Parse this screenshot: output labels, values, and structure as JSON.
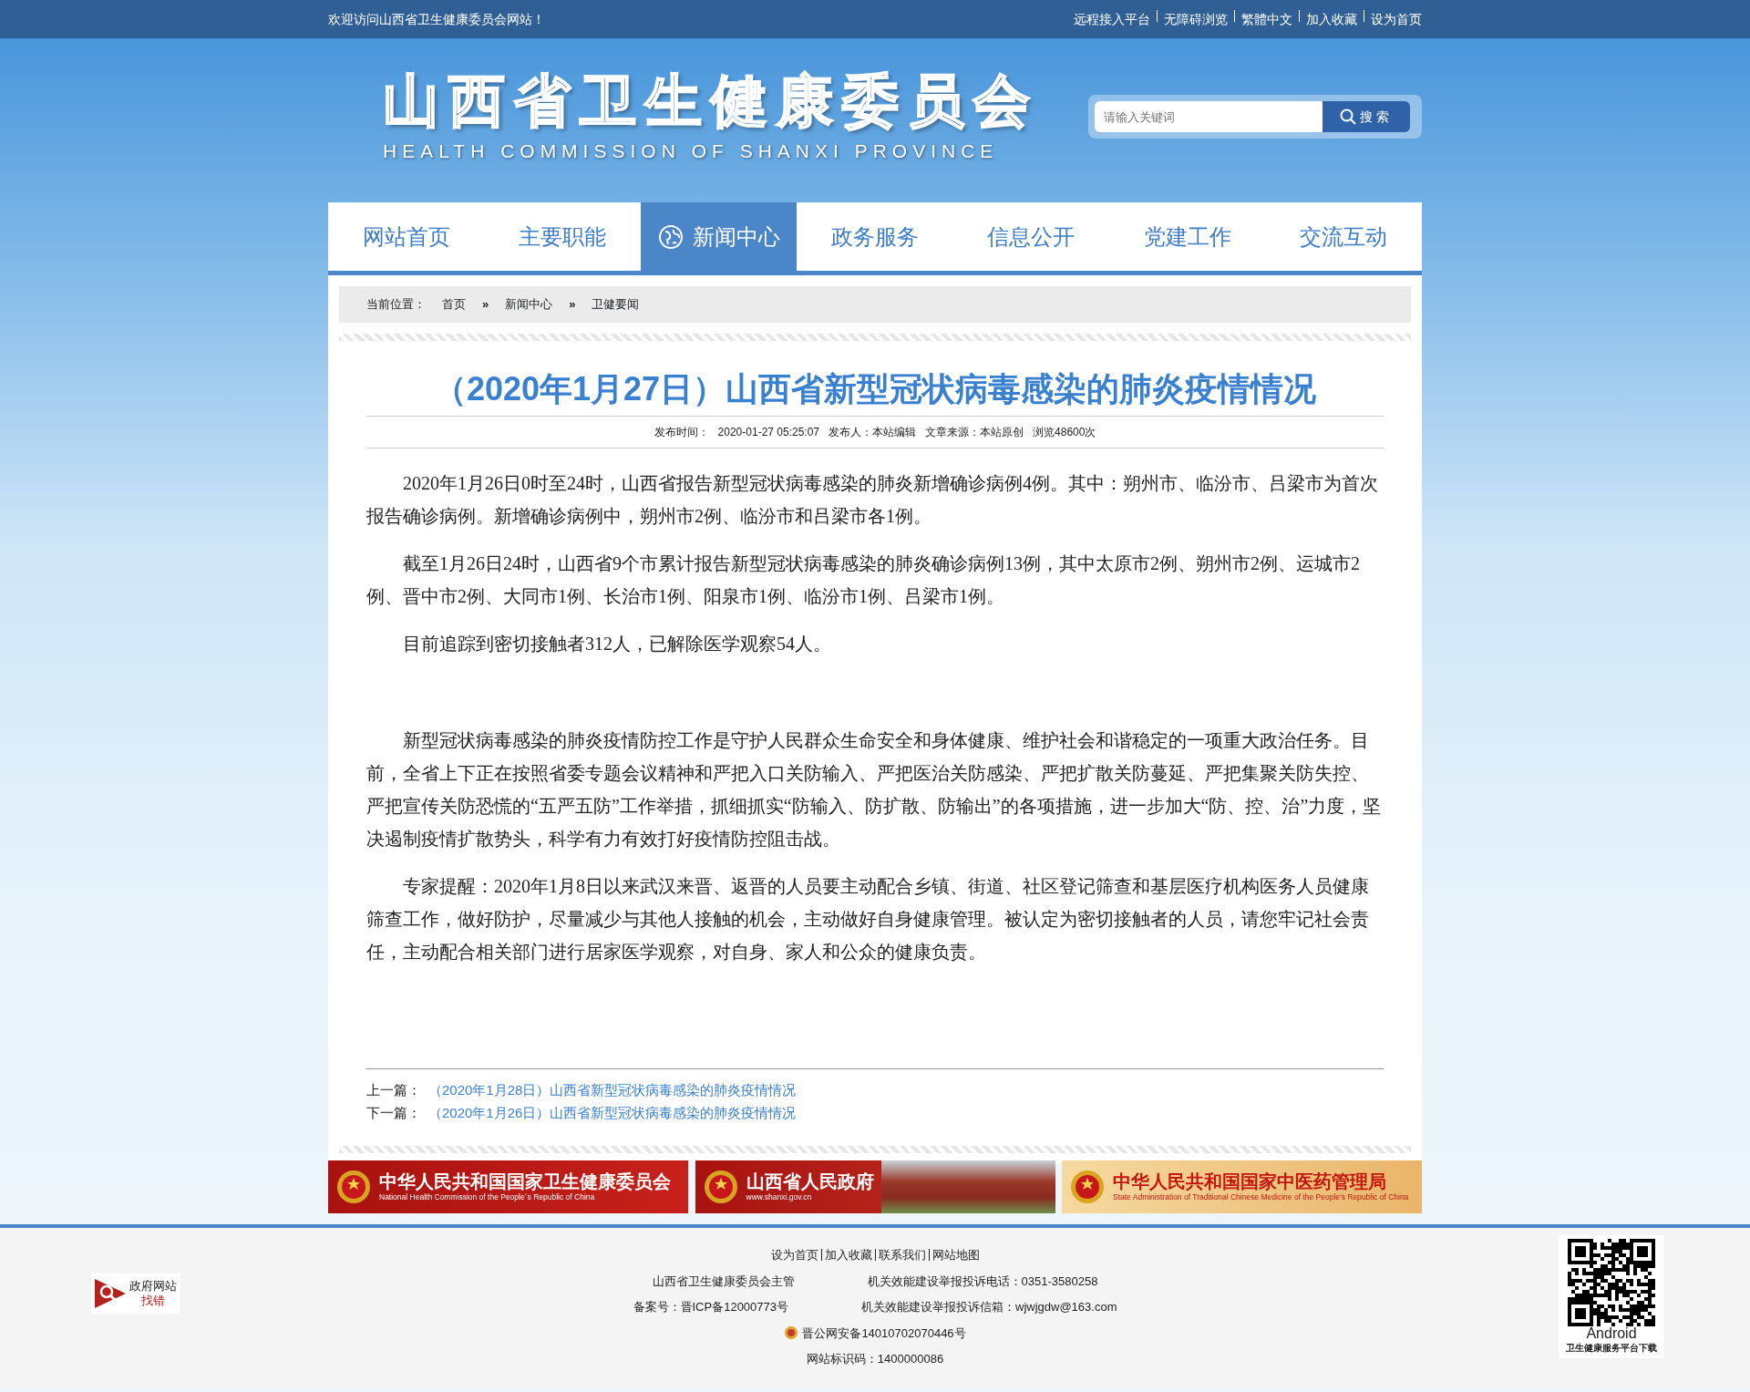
{
  "top_bar": {
    "welcome": "欢迎访问山西省卫生健康委员会网站！",
    "links": [
      "远程接入平台",
      "无障碍浏览",
      "繁體中文",
      "加入收藏",
      "设为首页"
    ]
  },
  "header": {
    "title": "山西省卫生健康委员会",
    "subtitle": "HEALTH COMMISSION OF SHANXI PROVINCE",
    "search": {
      "placeholder": "请输入关键词",
      "button": "搜索"
    }
  },
  "nav": [
    {
      "label": "网站首页",
      "selected": false
    },
    {
      "label": "主要职能",
      "selected": false
    },
    {
      "label": "新闻中心",
      "selected": true
    },
    {
      "label": "政务服务",
      "selected": false
    },
    {
      "label": "信息公开",
      "selected": false
    },
    {
      "label": "党建工作",
      "selected": false
    },
    {
      "label": "交流互动",
      "selected": false
    }
  ],
  "breadcrumb": {
    "label": "当前位置：",
    "separator": "»",
    "items": [
      "首页",
      "新闻中心",
      "卫健要闻"
    ]
  },
  "article": {
    "title": "（2020年1月27日）山西省新型冠状病毒感染的肺炎疫情情况",
    "meta": [
      "发布时间：",
      "2020-01-27 05:25:07",
      "发布人：本站编辑",
      "文章来源：本站原创",
      "浏览48600次"
    ],
    "paragraphs": [
      "2020年1月26日0时至24时，山西省报告新型冠状病毒感染的肺炎新增确诊病例4例。其中：朔州市、临汾市、吕梁市为首次报告确诊病例。新增确诊病例中，朔州市2例、临汾市和吕梁市各1例。",
      "截至1月26日24时，山西省9个市累计报告新型冠状病毒感染的肺炎确诊病例13例，其中太原市2例、朔州市2例、运城市2例、晋中市2例、大同市1例、长治市1例、阳泉市1例、临汾市1例、吕梁市1例。",
      "目前追踪到密切接触者312人，已解除医学观察54人。",
      "新型冠状病毒感染的肺炎疫情防控工作是守护人民群众生命安全和身体健康、维护社会和谐稳定的一项重大政治任务。目前，全省上下正在按照省委专题会议精神和严把入口关防输入、严把医治关防感染、严把扩散关防蔓延、严把集聚关防失控、严把宣传关防恐慌的“五严五防”工作举措，抓细抓实“防输入、防扩散、防输出”的各项措施，进一步加大“防、控、治”力度，坚决遏制疫情扩散势头，科学有力有效打好疫情防控阻击战。",
      "专家提醒：2020年1月8日以来武汉来晋、返晋的人员要主动配合乡镇、街道、社区登记筛查和基层医疗机构医务人员健康筛查工作，做好防护，尽量减少与其他人接触的机会，主动做好自身健康管理。被认定为密切接触者的人员，请您牢记社会责任，主动配合相关部门进行居家医学观察，对自身、家人和公众的健康负责。"
    ],
    "adjacent": [
      {
        "label": "上一篇：",
        "title": "（2020年1月28日）山西省新型冠状病毒感染的肺炎疫情情况"
      },
      {
        "label": "下一篇：",
        "title": "（2020年1月26日）山西省新型冠状病毒感染的肺炎疫情情况"
      }
    ]
  },
  "banners": [
    {
      "kind": "red",
      "title": "中华人民共和国国家卫生健康委员会",
      "subtitle": "National Health Commission of the People´s Republic of China"
    },
    {
      "kind": "photo",
      "title": "山西省人民政府",
      "subtitle": "www.shanxi.gov.cn"
    },
    {
      "kind": "gold",
      "title": "中华人民共和国国家中医药管理局",
      "subtitle": "State Administration of Traditional Chinese Medicine of the People's Republic of China"
    }
  ],
  "footer": {
    "links": [
      "设为首页",
      "加入收藏",
      "联系我们",
      "网站地图"
    ],
    "info": [
      [
        "山西省卫生健康委员会主管",
        "机关效能建设举报投诉电话：0351-3580258"
      ],
      [
        "备案号：晋ICP备12000773号",
        "机关效能建设举报投诉信箱：wjwjgdw@163.com"
      ]
    ],
    "police": "晋公网安备14010702070446号",
    "site_code": "网站标识码：1400000086",
    "gov_badge": [
      "政府网站",
      "找错"
    ],
    "qr": {
      "platform": "Android",
      "caption": "卫生健康服务平台下载"
    }
  }
}
